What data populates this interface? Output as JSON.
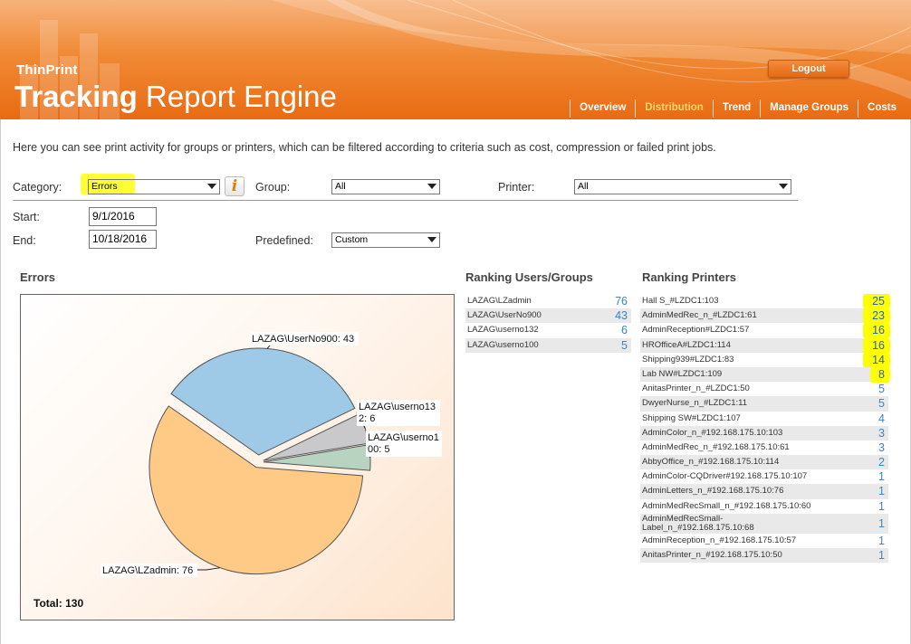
{
  "header": {
    "brand_small": "ThinPrint",
    "brand_bold": "Tracking",
    "brand_light": "Report Engine",
    "logout_label": "Logout",
    "nav": [
      {
        "label": "Overview",
        "active": false
      },
      {
        "label": "Distribution",
        "active": true
      },
      {
        "label": "Trend",
        "active": false
      },
      {
        "label": "Manage Groups",
        "active": false
      },
      {
        "label": "Costs",
        "active": false
      }
    ]
  },
  "intro": "Here you can see print activity for groups or printers, which can be filtered according to criteria such as cost, compression or failed print jobs.",
  "filters": {
    "category_label": "Category:",
    "category_value": "Errors",
    "info_icon": "i",
    "group_label": "Group:",
    "group_value": "All",
    "printer_label": "Printer:",
    "printer_value": "All",
    "start_label": "Start:",
    "start_value": "9/1/2016",
    "end_label": "End:",
    "end_value": "10/18/2016",
    "predefined_label": "Predefined:",
    "predefined_value": "Custom"
  },
  "chart_section_title": "Errors",
  "chart_data": {
    "type": "pie",
    "slices": [
      {
        "label": "LAZAG\\UserNo900",
        "value": 43,
        "color": "#9ecae8"
      },
      {
        "label": "LAZAG\\userno132",
        "value": 6,
        "color": "#c9c9cc"
      },
      {
        "label": "LAZAG\\userno100",
        "value": 5,
        "color": "#b8d4c0"
      },
      {
        "label": "LAZAG\\LZadmin",
        "value": 76,
        "color": "#ffca86"
      }
    ],
    "data_labels": [
      "LAZAG\\UserNo900: 43",
      "LAZAG\\userno13",
      "2: 6",
      "LAZAG\\userno1",
      "00: 5",
      "LAZAG\\LZadmin: 76"
    ],
    "total_label": "Total: 130"
  },
  "ranking_users": {
    "title": "Ranking Users/Groups",
    "items": [
      {
        "name": "LAZAG\\LZadmin",
        "value": "76"
      },
      {
        "name": "LAZAG\\UserNo900",
        "value": "43"
      },
      {
        "name": "LAZAG\\userno132",
        "value": "6"
      },
      {
        "name": "LAZAG\\userno100",
        "value": "5"
      }
    ]
  },
  "ranking_printers": {
    "title": "Ranking Printers",
    "items": [
      {
        "name": "Hall S_#LZDC1:103",
        "value": "25"
      },
      {
        "name": "AdminMedRec_n_#LZDC1:61",
        "value": "23"
      },
      {
        "name": "AdminReception#LZDC1:57",
        "value": "16"
      },
      {
        "name": "HROfficeA#LZDC1:114",
        "value": "16"
      },
      {
        "name": "Shipping939#LZDC1:83",
        "value": "14"
      },
      {
        "name": "Lab NW#LZDC1:109",
        "value": "8"
      },
      {
        "name": "AnitasPrinter_n_#LZDC1:50",
        "value": "5"
      },
      {
        "name": "DwyerNurse_n_#LZDC1:11",
        "value": "5"
      },
      {
        "name": "Shipping SW#LZDC1:107",
        "value": "4"
      },
      {
        "name": "AdminColor_n_#192.168.175.10:103",
        "value": "3"
      },
      {
        "name": "AdminMedRec_n_#192.168.175.10:61",
        "value": "3"
      },
      {
        "name": "AbbyOffice_n_#192.168.175.10:114",
        "value": "2"
      },
      {
        "name": "AdminColor-CQDriver#192.168.175.10:107",
        "value": "1"
      },
      {
        "name": "AdminLetters_n_#192.168.175.10:76",
        "value": "1"
      },
      {
        "name": "AdminMedRecSmall_n_#192.168.175.10:60",
        "value": "1"
      },
      {
        "name": "AdminMedRecSmall-Label_n_#192.168.175.10:68",
        "value": "1"
      },
      {
        "name": "AdminReception_n_#192.168.175.10:57",
        "value": "1"
      },
      {
        "name": "AnitasPrinter_n_#192.168.175.10:50",
        "value": "1"
      }
    ]
  }
}
